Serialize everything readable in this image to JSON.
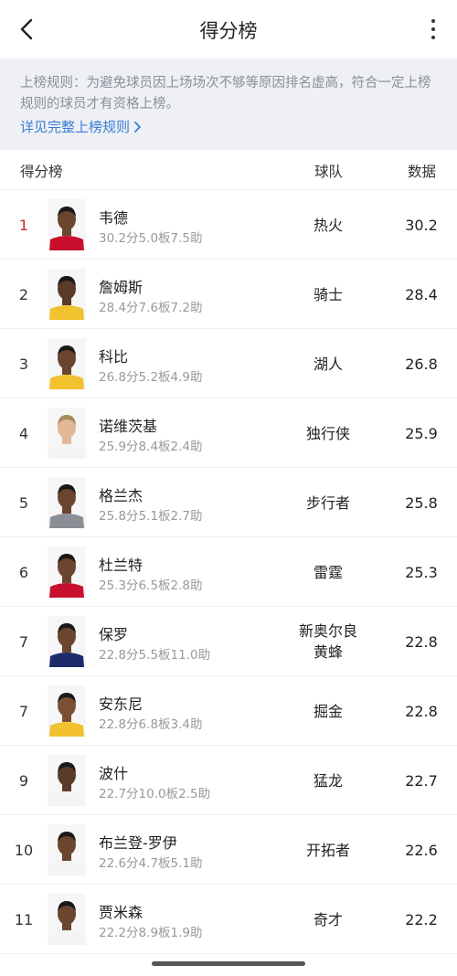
{
  "header": {
    "title": "得分榜",
    "back_icon": "chevron-left-icon",
    "more_icon": "more-vertical-icon"
  },
  "rules": {
    "text": "上榜规则：为避免球员因上场场次不够等原因排名虚高，符合一定上榜规则的球员才有资格上榜。",
    "link": "详见完整上榜规则",
    "link_icon": "chevron-right-icon",
    "link_color": "#3a7bd5"
  },
  "columns": {
    "rank": "得分榜",
    "team": "球队",
    "data": "数据"
  },
  "colors": {
    "top_rank": "#cc2a2a",
    "rules_bg": "#eef0f4"
  },
  "players": [
    {
      "rank": "1",
      "name": "韦德",
      "stats": "30.2分5.0板7.5助",
      "team": "热火",
      "value": "30.2",
      "jersey": "#c8102e",
      "skin": "#6b4530",
      "hair": "#1a1a1a"
    },
    {
      "rank": "2",
      "name": "詹姆斯",
      "stats": "28.4分7.6板7.2助",
      "team": "骑士",
      "value": "28.4",
      "jersey": "#f2c12e",
      "skin": "#5a3a28",
      "hair": "#1a1a1a"
    },
    {
      "rank": "3",
      "name": "科比",
      "stats": "26.8分5.2板4.9助",
      "team": "湖人",
      "value": "26.8",
      "jersey": "#f2c12e",
      "skin": "#6a4530",
      "hair": "#1a1a1a"
    },
    {
      "rank": "4",
      "name": "诺维茨基",
      "stats": "25.9分8.4板2.4助",
      "team": "独行侠",
      "value": "25.9",
      "jersey": "#f4f4f4",
      "skin": "#e3b898",
      "hair": "#a88a5e"
    },
    {
      "rank": "5",
      "name": "格兰杰",
      "stats": "25.8分5.1板2.7助",
      "team": "步行者",
      "value": "25.8",
      "jersey": "#8a8f96",
      "skin": "#6a4530",
      "hair": "#1a1a1a"
    },
    {
      "rank": "6",
      "name": "杜兰特",
      "stats": "25.3分6.5板2.8助",
      "team": "雷霆",
      "value": "25.3",
      "jersey": "#c8102e",
      "skin": "#6b4530",
      "hair": "#1a1a1a"
    },
    {
      "rank": "7",
      "name": "保罗",
      "stats": "22.8分5.5板11.0助",
      "team": "新奥尔良\n黄蜂",
      "value": "22.8",
      "jersey": "#1d2a6b",
      "skin": "#6b4530",
      "hair": "#1a1a1a"
    },
    {
      "rank": "7",
      "name": "安东尼",
      "stats": "22.8分6.8板3.4助",
      "team": "掘金",
      "value": "22.8",
      "jersey": "#f2c12e",
      "skin": "#7a5035",
      "hair": "#1a1a1a"
    },
    {
      "rank": "9",
      "name": "波什",
      "stats": "22.7分10.0板2.5助",
      "team": "猛龙",
      "value": "22.7",
      "jersey": "#f4f4f4",
      "skin": "#5a3a28",
      "hair": "#1a1a1a"
    },
    {
      "rank": "10",
      "name": "布兰登-罗伊",
      "stats": "22.6分4.7板5.1助",
      "team": "开拓者",
      "value": "22.6",
      "jersey": "#f4f4f4",
      "skin": "#6b4530",
      "hair": "#1a1a1a"
    },
    {
      "rank": "11",
      "name": "贾米森",
      "stats": "22.2分8.9板1.9助",
      "team": "奇才",
      "value": "22.2",
      "jersey": "#f4f4f4",
      "skin": "#6b4530",
      "hair": "#1a1a1a"
    }
  ]
}
